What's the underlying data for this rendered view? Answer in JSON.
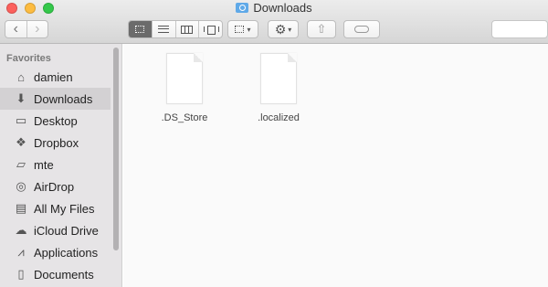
{
  "window": {
    "title": "Downloads"
  },
  "toolbar": {
    "back_label": "‹",
    "forward_label": "›",
    "share_label": "⇧",
    "gear_label": "⚙",
    "chevron": "▾"
  },
  "sidebar": {
    "heading": "Favorites",
    "items": [
      {
        "label": "damien",
        "icon": "home-icon",
        "glyph": "⌂"
      },
      {
        "label": "Downloads",
        "icon": "download-icon",
        "glyph": "⬇",
        "selected": true
      },
      {
        "label": "Desktop",
        "icon": "desktop-icon",
        "glyph": "▭"
      },
      {
        "label": "Dropbox",
        "icon": "dropbox-icon",
        "glyph": "❖"
      },
      {
        "label": "mte",
        "icon": "folder-icon",
        "glyph": "▱"
      },
      {
        "label": "AirDrop",
        "icon": "airdrop-icon",
        "glyph": "◎"
      },
      {
        "label": "All My Files",
        "icon": "all-files-icon",
        "glyph": "▤"
      },
      {
        "label": "iCloud Drive",
        "icon": "cloud-icon",
        "glyph": "☁"
      },
      {
        "label": "Applications",
        "icon": "applications-icon",
        "glyph": "⩘"
      },
      {
        "label": "Documents",
        "icon": "document-icon",
        "glyph": "▯"
      }
    ]
  },
  "files": [
    {
      "name": ".DS_Store"
    },
    {
      "name": ".localized"
    }
  ],
  "colors": {
    "close": "#fc605c",
    "minimize": "#fdbc40",
    "maximize": "#34c84a",
    "selected_item": "#d3d1d3",
    "sidebar_bg": "#e6e4e6"
  }
}
